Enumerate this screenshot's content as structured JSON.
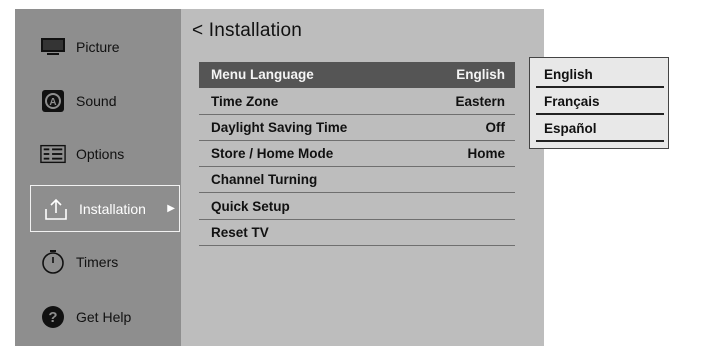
{
  "sidebar": {
    "items": [
      {
        "label": "Picture",
        "icon": "tv-icon"
      },
      {
        "label": "Sound",
        "icon": "sound-icon"
      },
      {
        "label": "Options",
        "icon": "options-icon"
      },
      {
        "label": "Installation",
        "icon": "installation-icon",
        "active": true
      },
      {
        "label": "Timers",
        "icon": "timer-icon"
      },
      {
        "label": "Get Help",
        "icon": "help-icon"
      }
    ],
    "active_arrow": "▶"
  },
  "panel": {
    "back_glyph": "<",
    "title": "Installation",
    "rows": [
      {
        "label": "Menu Language",
        "value": "English",
        "selected": true
      },
      {
        "label": "Time Zone",
        "value": "Eastern"
      },
      {
        "label": "Daylight Saving Time",
        "value": "Off"
      },
      {
        "label": "Store / Home Mode",
        "value": "Home"
      },
      {
        "label": "Channel Turning",
        "value": ""
      },
      {
        "label": "Quick Setup",
        "value": ""
      },
      {
        "label": "Reset TV",
        "value": ""
      }
    ]
  },
  "dropdown": {
    "options": [
      "English",
      "Français",
      "Español"
    ]
  },
  "colors": {
    "sidebar_bg": "#8e8e8e",
    "panel_bg": "#bdbdbd",
    "selected_row_bg": "#555555",
    "dropdown_bg": "#e8e8e8"
  }
}
